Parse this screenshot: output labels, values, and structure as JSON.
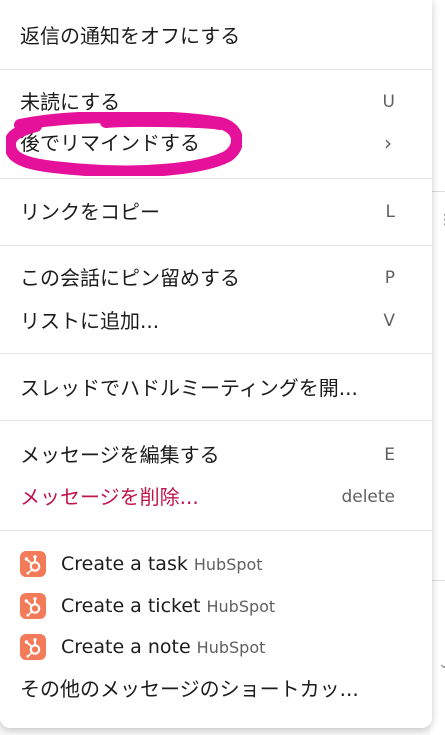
{
  "menu": {
    "groups": [
      {
        "items": [
          {
            "label": "返信の通知をオフにする",
            "shortcut": ""
          }
        ]
      },
      {
        "items": [
          {
            "label": "未読にする",
            "shortcut": "U"
          },
          {
            "label": "後でリマインドする",
            "shortcut": "›"
          }
        ]
      },
      {
        "items": [
          {
            "label": "リンクをコピー",
            "shortcut": "L"
          }
        ]
      },
      {
        "items": [
          {
            "label": "この会話にピン留めする",
            "shortcut": "P"
          },
          {
            "label": "リストに追加...",
            "shortcut": "V"
          }
        ]
      },
      {
        "items": [
          {
            "label": "スレッドでハドルミーティングを開...",
            "shortcut": ""
          }
        ]
      },
      {
        "items": [
          {
            "label": "メッセージを編集する",
            "shortcut": "E"
          },
          {
            "label": "メッセージを削除...",
            "shortcut": "delete"
          }
        ]
      }
    ],
    "apps": [
      {
        "label": "Create a task",
        "app": "HubSpot",
        "icon": "hubspot-icon"
      },
      {
        "label": "Create a ticket",
        "app": "HubSpot",
        "icon": "hubspot-icon"
      },
      {
        "label": "Create a note",
        "app": "HubSpot",
        "icon": "hubspot-icon"
      }
    ],
    "more_shortcuts": "その他のメッセージのショートカッ..."
  },
  "colors": {
    "danger": "#c0154a",
    "highlight": "#e5119a",
    "hubspot": "#f37b5a"
  }
}
